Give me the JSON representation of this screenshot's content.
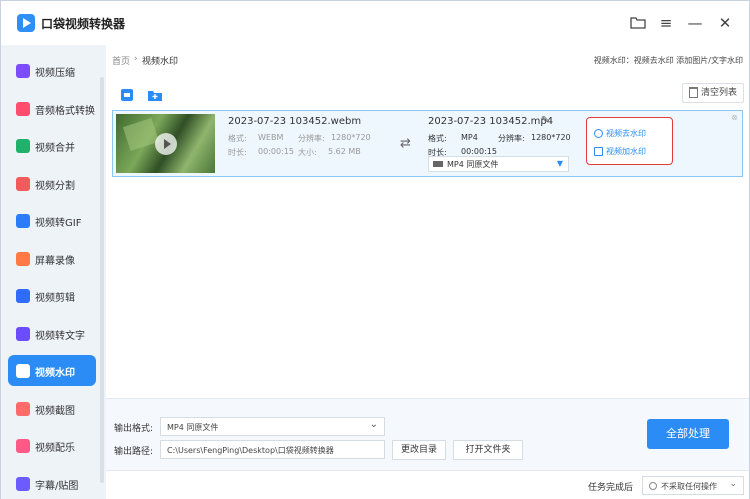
{
  "app": {
    "title": "口袋视频转换器"
  },
  "sidebar": {
    "items": [
      {
        "label": "视频压缩",
        "color": "#7c4dff"
      },
      {
        "label": "音频格式转换",
        "color": "#ff4d6d"
      },
      {
        "label": "视频合并",
        "color": "#20b26b"
      },
      {
        "label": "视频分割",
        "color": "#f15b5b"
      },
      {
        "label": "视频转GIF",
        "color": "#2b7cf6"
      },
      {
        "label": "屏幕录像",
        "color": "#ff7a45"
      },
      {
        "label": "视频剪辑",
        "color": "#2f6bff"
      },
      {
        "label": "视频转文字",
        "color": "#6b4cff"
      },
      {
        "label": "视频水印",
        "color": "#ff4d4f"
      },
      {
        "label": "视频截图",
        "color": "#ff6a6a"
      },
      {
        "label": "视频配乐",
        "color": "#ff5a87"
      },
      {
        "label": "字幕/贴图",
        "color": "#6c5cff"
      }
    ],
    "active_index": 8
  },
  "breadcrumb": {
    "home": "首页",
    "separator": "›",
    "current": "视频水印",
    "hint": "视频水印：视频去水印 添加图片/文字水印"
  },
  "toolbar": {
    "clear_label": "清空列表"
  },
  "file": {
    "source": {
      "name": "2023-07-23 103452.webm",
      "format_label": "格式:",
      "format": "WEBM",
      "resolution_label": "分辨率:",
      "resolution": "1280*720",
      "duration_label": "时长:",
      "duration": "00:00:15",
      "size_label": "大小:",
      "size": "5.62 MB"
    },
    "output": {
      "name": "2023-07-23 103452.mp4",
      "format_label": "格式:",
      "format": "MP4",
      "resolution_label": "分辨率:",
      "resolution": "1280*720",
      "duration_label": "时长:",
      "duration": "00:00:15",
      "format_select": "MP4  同原文件"
    },
    "actions": {
      "remove_watermark": "视频去水印",
      "add_watermark": "视频加水印"
    }
  },
  "bottom": {
    "output_format_label": "输出格式:",
    "output_format_value": "MP4  同原文件",
    "output_path_label": "输出路径:",
    "output_path_value": "C:\\Users\\FengPing\\Desktop\\口袋视频转换器",
    "change_dir_label": "更改目录",
    "open_folder_label": "打开文件夹",
    "process_all_label": "全部处理"
  },
  "status": {
    "after_done_label": "任务完成后",
    "after_done_value": "不采取任何操作"
  },
  "colors": {
    "accent": "#2b8cf6",
    "highlight_border": "#e13c37"
  }
}
